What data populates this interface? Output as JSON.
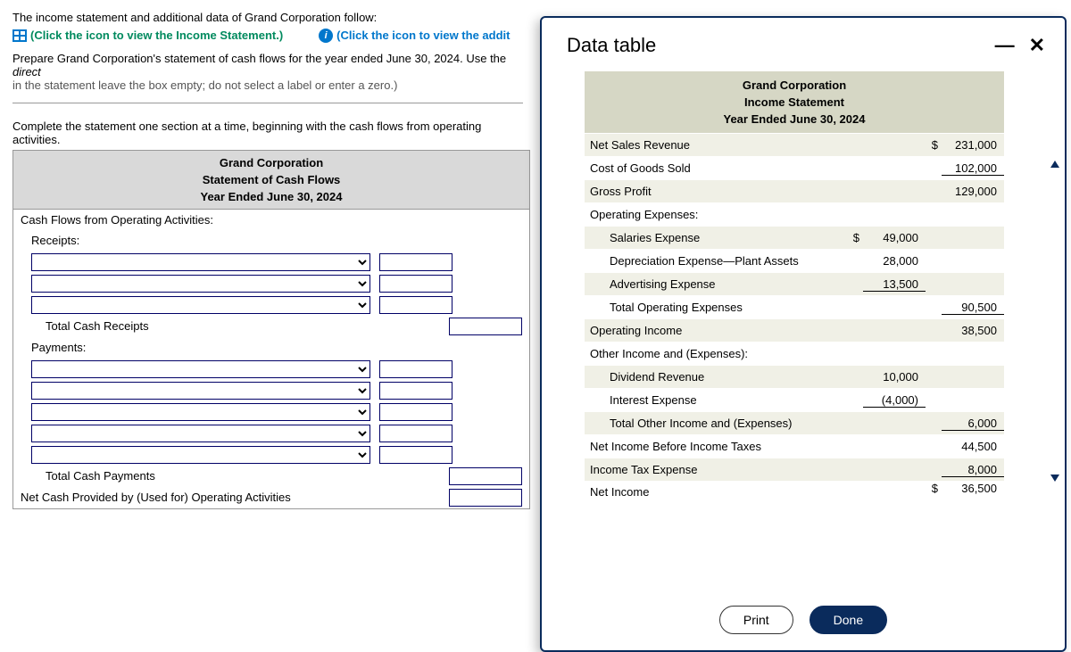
{
  "problem": {
    "line1": "The income statement and additional data of Grand Corporation follow:",
    "link1": "(Click the icon to view the Income Statement.)",
    "link2": "(Click the icon to view the addit",
    "instr_a": "Prepare Grand Corporation's statement of cash flows for the year ended June 30, 2024. Use the ",
    "instr_italic": "direct",
    "instr_b": "in the statement leave the box empty; do not select a label or enter a zero.)",
    "hint": "Complete the statement one section at a time, beginning with the cash flows from operating activities."
  },
  "worksheet": {
    "title_company": "Grand Corporation",
    "title_stmt": "Statement of Cash Flows",
    "title_period": "Year Ended June 30, 2024",
    "rows": {
      "op_header": "Cash Flows from Operating Activities:",
      "receipts": "Receipts:",
      "total_receipts": "Total Cash Receipts",
      "payments": "Payments:",
      "total_payments": "Total Cash Payments",
      "net_op": "Net Cash Provided by (Used for) Operating Activities"
    }
  },
  "modal": {
    "title": "Data table",
    "print": "Print",
    "done": "Done"
  },
  "income": {
    "company": "Grand Corporation",
    "stmt": "Income Statement",
    "period": "Year Ended June 30, 2024",
    "rows": [
      {
        "label": "Net Sales Revenue",
        "indent": false,
        "d1": "",
        "c1": "",
        "d2": "$",
        "c2": "231,000",
        "shade": true,
        "u2": false
      },
      {
        "label": "Cost of Goods Sold",
        "indent": false,
        "d1": "",
        "c1": "",
        "d2": "",
        "c2": "102,000",
        "shade": false,
        "u2": true
      },
      {
        "label": "Gross Profit",
        "indent": false,
        "d1": "",
        "c1": "",
        "d2": "",
        "c2": "129,000",
        "shade": true,
        "u2": false
      },
      {
        "label": "Operating Expenses:",
        "indent": false,
        "d1": "",
        "c1": "",
        "d2": "",
        "c2": "",
        "shade": false,
        "u2": false
      },
      {
        "label": "Salaries Expense",
        "indent": true,
        "d1": "$",
        "c1": "49,000",
        "d2": "",
        "c2": "",
        "shade": true,
        "u2": false
      },
      {
        "label": "Depreciation Expense—Plant Assets",
        "indent": true,
        "d1": "",
        "c1": "28,000",
        "d2": "",
        "c2": "",
        "shade": false,
        "u2": false
      },
      {
        "label": "Advertising Expense",
        "indent": true,
        "d1": "",
        "c1": "13,500",
        "d2": "",
        "c2": "",
        "shade": true,
        "u1": true,
        "u2": false
      },
      {
        "label": "Total Operating Expenses",
        "indent": true,
        "d1": "",
        "c1": "",
        "d2": "",
        "c2": "90,500",
        "shade": false,
        "u2": true
      },
      {
        "label": "Operating Income",
        "indent": false,
        "d1": "",
        "c1": "",
        "d2": "",
        "c2": "38,500",
        "shade": true,
        "u2": false
      },
      {
        "label": "Other Income and (Expenses):",
        "indent": false,
        "d1": "",
        "c1": "",
        "d2": "",
        "c2": "",
        "shade": false,
        "u2": false
      },
      {
        "label": "Dividend Revenue",
        "indent": true,
        "d1": "",
        "c1": "10,000",
        "d2": "",
        "c2": "",
        "shade": true,
        "u2": false
      },
      {
        "label": "Interest Expense",
        "indent": true,
        "d1": "",
        "c1": "(4,000)",
        "d2": "",
        "c2": "",
        "shade": false,
        "u1": true,
        "u2": false
      },
      {
        "label": "Total Other Income and (Expenses)",
        "indent": true,
        "d1": "",
        "c1": "",
        "d2": "",
        "c2": "6,000",
        "shade": true,
        "u2": true
      },
      {
        "label": "Net Income Before Income Taxes",
        "indent": false,
        "d1": "",
        "c1": "",
        "d2": "",
        "c2": "44,500",
        "shade": false,
        "u2": false
      },
      {
        "label": "Income Tax Expense",
        "indent": false,
        "d1": "",
        "c1": "",
        "d2": "",
        "c2": "8,000",
        "shade": true,
        "u2": true
      },
      {
        "label": "Net Income",
        "indent": false,
        "d1": "",
        "c1": "",
        "d2": "$",
        "c2": "36,500",
        "shade": false,
        "u2": false,
        "cut": true
      }
    ]
  }
}
